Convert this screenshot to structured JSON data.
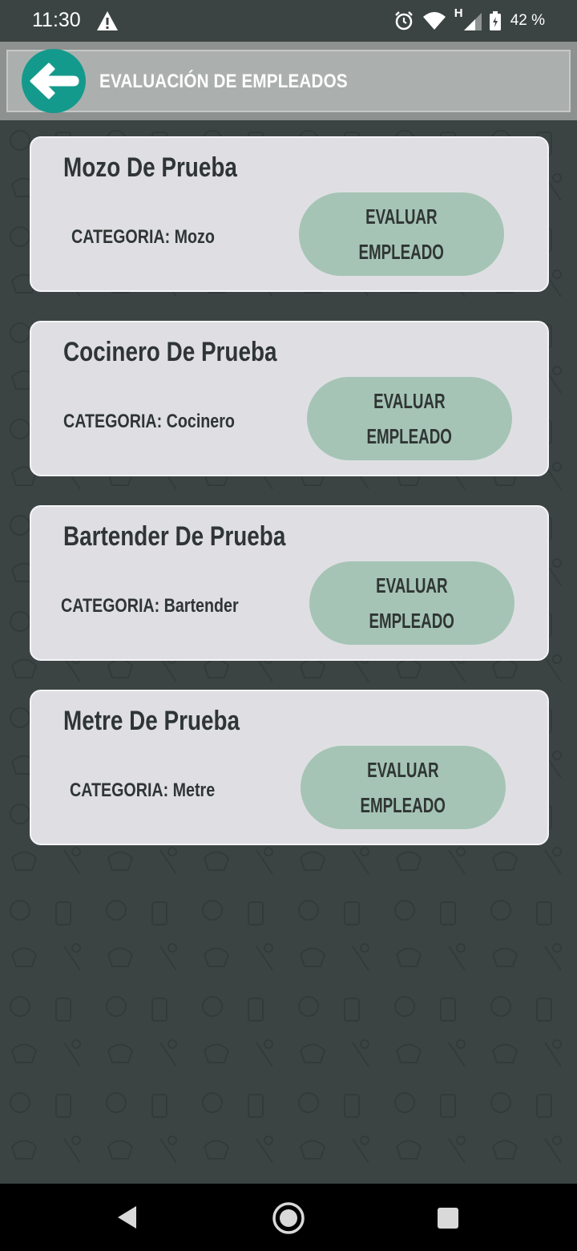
{
  "status_bar": {
    "time": "11:30",
    "battery": "42 %",
    "network_type": "H",
    "icons": [
      "warning-icon",
      "alarm-icon",
      "wifi-icon",
      "signal-icon",
      "battery-icon"
    ]
  },
  "app_bar": {
    "title": "EVALUACIÓN DE EMPLEADOS",
    "back_icon": "arrow-left-icon"
  },
  "employees": [
    {
      "name": "Mozo De Prueba",
      "category": "CATEGORIA: Mozo",
      "button_line1": "EVALUAR",
      "button_line2": "EMPLEADO"
    },
    {
      "name": "Cocinero De Prueba",
      "category": "CATEGORIA: Cocinero",
      "button_line1": "EVALUAR",
      "button_line2": "EMPLEADO"
    },
    {
      "name": "Bartender De Prueba",
      "category": "CATEGORIA: Bartender",
      "button_line1": "EVALUAR",
      "button_line2": "EMPLEADO"
    },
    {
      "name": "Metre De Prueba",
      "category": "CATEGORIA: Metre",
      "button_line1": "EVALUAR",
      "button_line2": "EMPLEADO"
    }
  ],
  "colors": {
    "background": "#3b4443",
    "accent": "#149a8c",
    "card": "#dfdfe3",
    "button": "#a5c4b5",
    "app_bar": "#abb0ae"
  },
  "nav_bar": {
    "icons": [
      "nav-back-icon",
      "nav-home-icon",
      "nav-recent-icon"
    ]
  }
}
